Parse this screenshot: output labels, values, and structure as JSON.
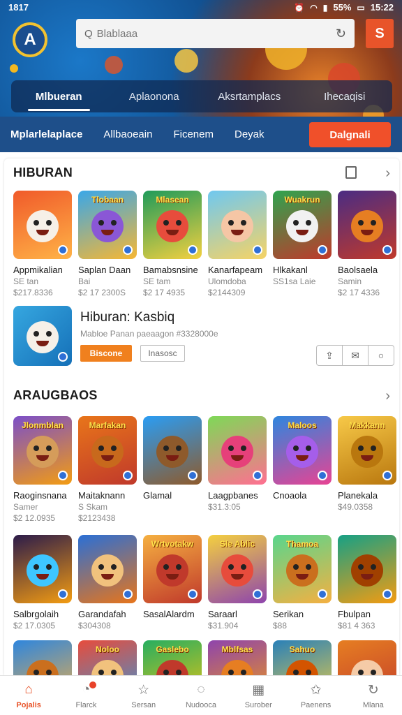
{
  "status": {
    "time": "1817",
    "battery": "55%",
    "clock": "15:22",
    "icons": [
      "alarm-icon",
      "wifi-icon",
      "signal-icon",
      "battery-icon"
    ]
  },
  "header": {
    "logo_letter": "A",
    "search_placeholder": "Blablaaa",
    "action_glyph": "S",
    "tabs": [
      "Mlbueran",
      "Aplaonona",
      "Aksrtamplacs",
      "Ihecaqisi"
    ],
    "subnav": [
      "Mplarlelaplace",
      "Allbaoeain",
      "Ficenem",
      "Deyak"
    ],
    "cta": "Dalgnali"
  },
  "section1": {
    "title": "HIBURAN",
    "apps": [
      {
        "name": "Appmikalian",
        "sub1": "SE tan",
        "sub2": "$217.8336",
        "color1": "#f05a2a",
        "color2": "#ffb347",
        "face": "#f6f0e8",
        "label": ""
      },
      {
        "name": "Saplan Daan",
        "sub1": "Bai",
        "sub2": "$2 17 2300S",
        "color1": "#3aa7e8",
        "color2": "#f7b733",
        "face": "#8a57d6",
        "label": "Tlobaan"
      },
      {
        "name": "Bamabsnsine",
        "sub1": "SE tam",
        "sub2": "$2 17 4935",
        "color1": "#1f9b5a",
        "color2": "#f4d03f",
        "face": "#e74c3c",
        "label": "Mlasean"
      },
      {
        "name": "Kanarfapeam",
        "sub1": "Ulomdoba",
        "sub2": "$2144309",
        "color1": "#6fc8f0",
        "color2": "#f6d365",
        "face": "#f5c6a5",
        "label": ""
      },
      {
        "name": "Hlkakanl",
        "sub1": "SS1sa Laie",
        "sub2": "",
        "color1": "#2ea44f",
        "color2": "#c0392b",
        "face": "#f1f1f1",
        "label": "Wuakrun"
      },
      {
        "name": "Baolsaela",
        "sub1": "Samin",
        "sub2": "$2 17 4336",
        "color1": "#4a2c83",
        "color2": "#c0392b",
        "face": "#e67e22",
        "label": ""
      }
    ]
  },
  "feature": {
    "title": "Hiburan: Kasbiq",
    "subtitle": "Mabloe Panan  paeaagon #3328000e",
    "primary": "Biscone",
    "secondary": "Inasosc",
    "actions": [
      "share-icon",
      "gift-icon",
      "more-icon"
    ]
  },
  "section2": {
    "title": "ARAUGBAOS",
    "apps": [
      {
        "name": "Raoginsnana",
        "sub1": "Samer",
        "sub2": "$2 12.0935",
        "color1": "#7b4fc9",
        "color2": "#f39c12",
        "face": "#d59c5a",
        "label": "Jlonmblan"
      },
      {
        "name": "Maitaknann",
        "sub1": "S Skam",
        "sub2": "$2123438",
        "color1": "#e8751a",
        "color2": "#c0392b",
        "face": "#c8691c",
        "label": "Marfakan"
      },
      {
        "name": "Glamal",
        "sub1": "",
        "sub2": "",
        "color1": "#2a9df4",
        "color2": "#8e5a2b",
        "face": "#8e5a2b",
        "label": ""
      },
      {
        "name": "Laagpbanes",
        "sub1": "$31.3:05",
        "sub2": "",
        "color1": "#7ed957",
        "color2": "#ff6f91",
        "face": "#e6407a",
        "label": ""
      },
      {
        "name": "Cnoaola",
        "sub1": "",
        "sub2": "",
        "color1": "#2e86de",
        "color2": "#e84393",
        "face": "#a55eea",
        "label": "Maloos"
      },
      {
        "name": "Planekala",
        "sub1": "$49.0358",
        "sub2": "",
        "color1": "#f7c948",
        "color2": "#b9770e",
        "face": "#b9770e",
        "label": "Makkann"
      }
    ],
    "apps_row2": [
      {
        "name": "Salbrgolaih",
        "sub1": "$2 17.0305",
        "sub2": "",
        "color1": "#2b1b4a",
        "color2": "#f39c12",
        "face": "#3ec6ff",
        "label": ""
      },
      {
        "name": "Garandafah",
        "sub1": "$304308",
        "sub2": "",
        "color1": "#2a6fd6",
        "color2": "#e8751a",
        "face": "#f1c27d",
        "label": ""
      },
      {
        "name": "SasalAlardm",
        "sub1": "",
        "sub2": "",
        "color1": "#f5b041",
        "color2": "#c0392b",
        "face": "#c0392b",
        "label": "Wrtvotakw"
      },
      {
        "name": "Saraarl",
        "sub1": "$31.904",
        "sub2": "",
        "color1": "#f4d03f",
        "color2": "#8e44ad",
        "face": "#e74c3c",
        "label": "Sle Ablic"
      },
      {
        "name": "Serikan",
        "sub1": "$88",
        "sub2": "",
        "color1": "#58d68d",
        "color2": "#f5b041",
        "face": "#ca6f1e",
        "label": "Thamoa"
      },
      {
        "name": "Fbulpan",
        "sub1": "$81 4 363",
        "sub2": "",
        "color1": "#16a085",
        "color2": "#f39c12",
        "face": "#a04000",
        "label": ""
      }
    ],
    "apps_row3": [
      {
        "color1": "#2e86de",
        "color2": "#f5b041",
        "face": "#ca6f1e",
        "label": ""
      },
      {
        "color1": "#e74c3c",
        "color2": "#3498db",
        "face": "#f1c27d",
        "label": "Noloo"
      },
      {
        "color1": "#27ae60",
        "color2": "#f1c40f",
        "face": "#c0392b",
        "label": "Gaslebo"
      },
      {
        "color1": "#8e44ad",
        "color2": "#f39c12",
        "face": "#e67e22",
        "label": "Mblfsas"
      },
      {
        "color1": "#2980b9",
        "color2": "#f4d03f",
        "face": "#d35400",
        "label": "Sahuo"
      },
      {
        "color1": "#e67e22",
        "color2": "#c0392b",
        "face": "#f5cba7",
        "label": ""
      }
    ]
  },
  "bottomnav": [
    {
      "label": "Pojalis",
      "icon": "home-icon",
      "glyph": "⌂"
    },
    {
      "label": "Flarck",
      "icon": "chat-icon",
      "glyph": "◔"
    },
    {
      "label": "Sersan",
      "icon": "star-icon",
      "glyph": "☆"
    },
    {
      "label": "Nudooca",
      "icon": "search-icon",
      "glyph": "◌"
    },
    {
      "label": "Surober",
      "icon": "grid-icon",
      "glyph": "▦"
    },
    {
      "label": "Paenens",
      "icon": "badge-icon",
      "glyph": "✩"
    },
    {
      "label": "Mlana",
      "icon": "refresh-icon",
      "glyph": "↻"
    }
  ]
}
